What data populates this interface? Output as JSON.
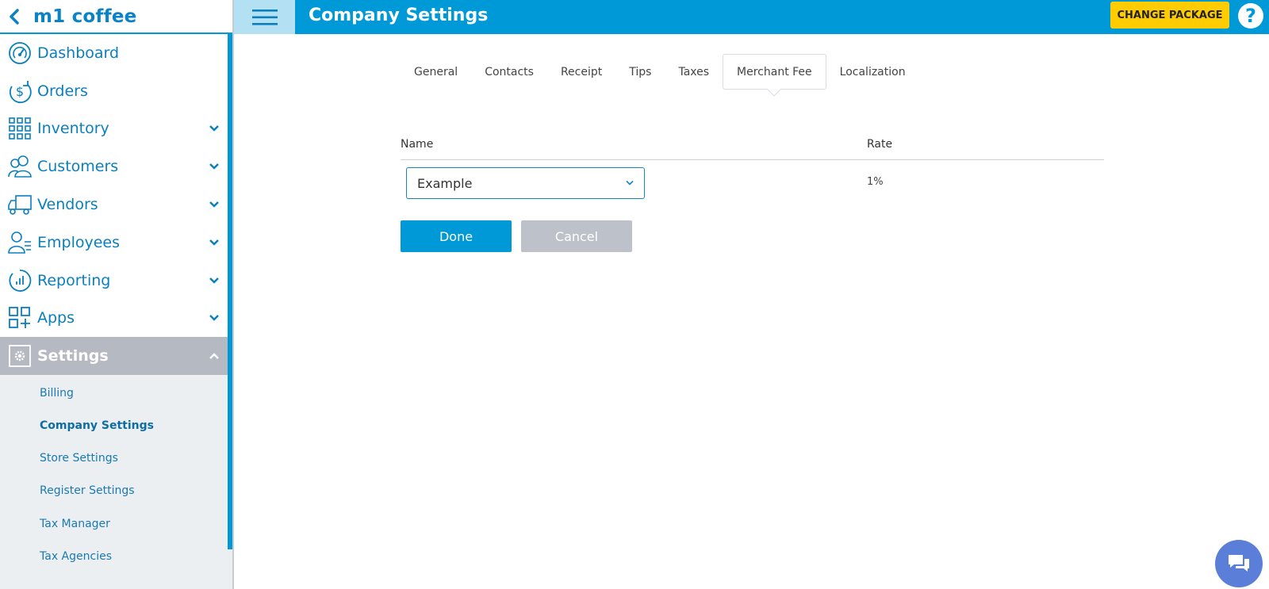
{
  "brand": {
    "name": "m1 coffee"
  },
  "header": {
    "title": "Company Settings",
    "change_package": "CHANGE PACKAGE",
    "help": "?"
  },
  "sidebar": {
    "items": [
      {
        "label": "Dashboard",
        "icon": "dashboard-icon",
        "expandable": false
      },
      {
        "label": "Orders",
        "icon": "orders-dollar-icon",
        "expandable": false
      },
      {
        "label": "Inventory",
        "icon": "grid-icon",
        "expandable": true
      },
      {
        "label": "Customers",
        "icon": "customers-icon",
        "expandable": true
      },
      {
        "label": "Vendors",
        "icon": "truck-icon",
        "expandable": true
      },
      {
        "label": "Employees",
        "icon": "employees-icon",
        "expandable": true
      },
      {
        "label": "Reporting",
        "icon": "reporting-icon",
        "expandable": true
      },
      {
        "label": "Apps",
        "icon": "apps-icon",
        "expandable": true
      },
      {
        "label": "Settings",
        "icon": "settings-gear-icon",
        "expandable": true,
        "active": true
      }
    ],
    "sub_items": [
      {
        "label": "Billing"
      },
      {
        "label": "Company Settings",
        "current": true
      },
      {
        "label": "Store Settings"
      },
      {
        "label": "Register Settings"
      },
      {
        "label": "Tax Manager"
      },
      {
        "label": "Tax Agencies"
      }
    ]
  },
  "tabs": [
    {
      "label": "General"
    },
    {
      "label": "Contacts"
    },
    {
      "label": "Receipt"
    },
    {
      "label": "Tips"
    },
    {
      "label": "Taxes"
    },
    {
      "label": "Merchant Fee",
      "selected": true
    },
    {
      "label": "Localization"
    }
  ],
  "fee_table": {
    "columns": [
      "Name",
      "Rate"
    ],
    "rows": [
      {
        "name": "Example",
        "rate": "1%"
      }
    ]
  },
  "actions": {
    "done": "Done",
    "cancel": "Cancel"
  },
  "colors": {
    "primary": "#0099d8",
    "accent": "#ffcc00",
    "sidebar_text": "#0a7fc0",
    "active_bg": "#b5b9c2",
    "chat": "#5b7fd9"
  }
}
